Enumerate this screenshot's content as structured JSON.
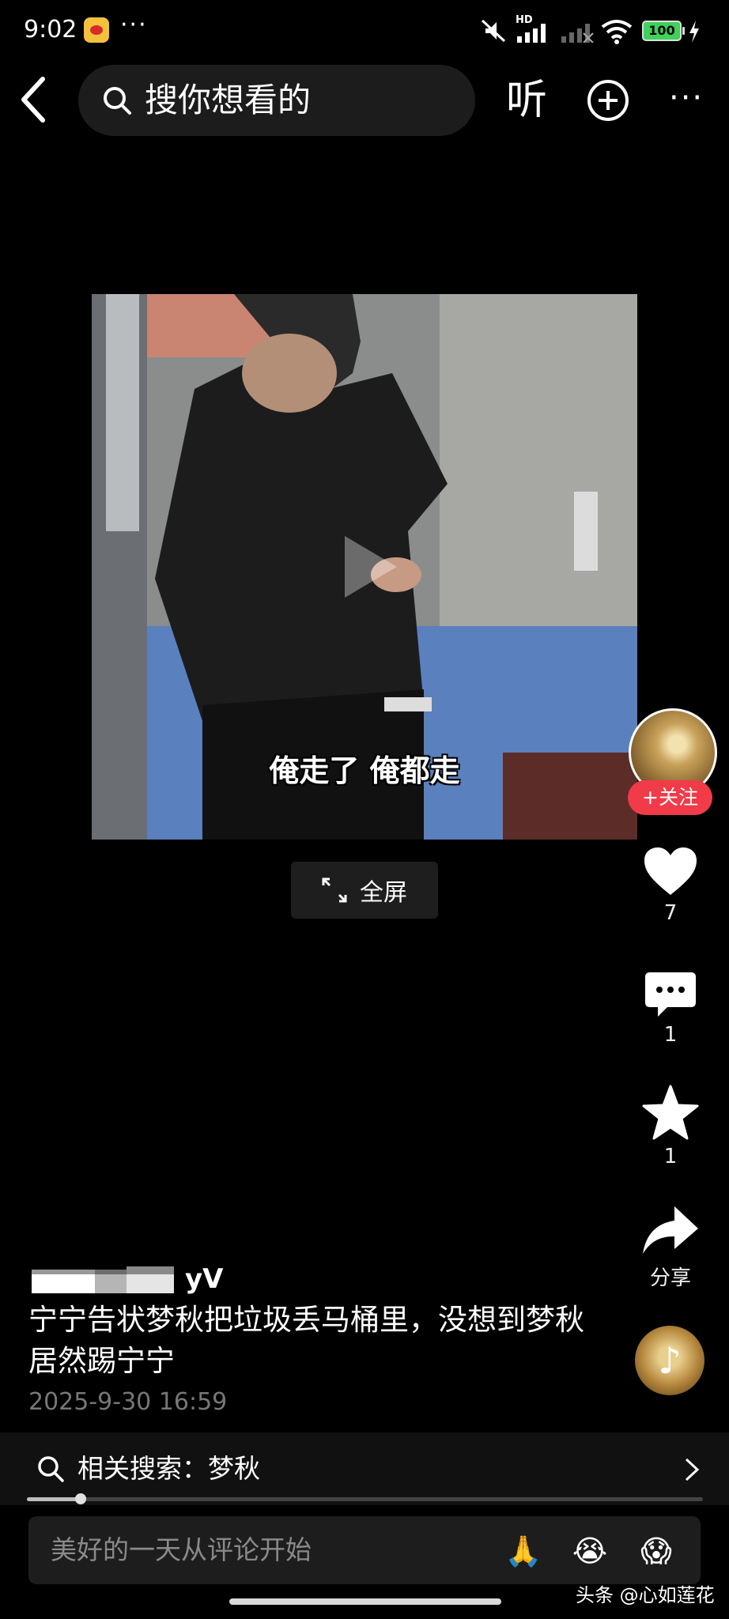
{
  "status_bar": {
    "time": "9:02",
    "more": "···",
    "icons": [
      "weibo-app-icon",
      "mute-icon",
      "cellular-hd-icon",
      "cellular-no-signal-icon",
      "wifi-icon",
      "charging-icon"
    ],
    "hd_label": "HD",
    "battery": "100",
    "battery_color": "#3fd15c"
  },
  "top_bar": {
    "search_placeholder": "搜你想看的",
    "listen_label": "听",
    "more_label": "···"
  },
  "video": {
    "subtitle": "俺走了 俺都走",
    "fullscreen_label": "全屏"
  },
  "rail": {
    "follow_label": "+关注",
    "follow_color": "#f13b48",
    "like_count": "7",
    "comment_count": "1",
    "favorite_count": "1",
    "share_label": "分享"
  },
  "post": {
    "author_suffix": "yV",
    "title": "宁宁告状梦秋把垃圾丢马桶里，没想到梦秋居然踢宁宁",
    "date": "2025-9-30 16:59"
  },
  "related": {
    "label": "相关搜索：梦秋"
  },
  "progress": {
    "fraction": 0.08
  },
  "comment_bar": {
    "placeholder": "美好的一天从评论开始",
    "emojis": [
      "🙏",
      "😭",
      "😱"
    ]
  },
  "watermark": "头条 @心如莲花"
}
